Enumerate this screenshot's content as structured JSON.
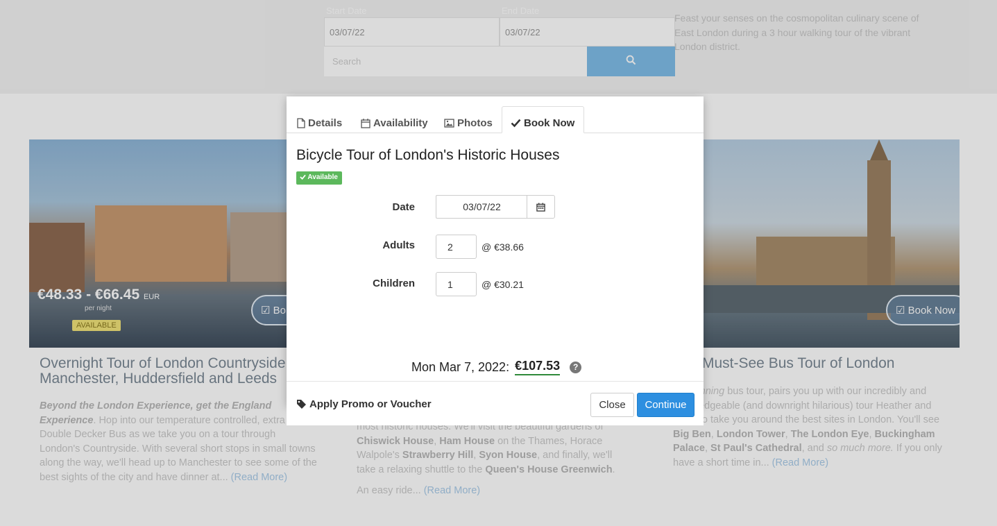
{
  "hero": {
    "start_date_label": "Start Date",
    "end_date_label": "End Date",
    "start_date_value": "03/07/22",
    "end_date_value": "03/07/22",
    "search_placeholder": "Search",
    "description": "Feast your senses on the cosmopolitan culinary scene of East London during a 3 hour walking tour of the vibrant London district."
  },
  "cards": {
    "left": {
      "price": "€48.33 - €66.45",
      "currency": "EUR",
      "per_night": "per night",
      "badge": "AVAILABLE",
      "book_label": "Bo",
      "title": "Overnight Tour of London Countryside, Manchester, Huddersfield and Leeds",
      "desc_bold": "Beyond the London Experience, get the England Experience",
      "desc_text": ". Hop into our temperature controlled, extra comfy, Double Decker Bus as we take you on a tour through London's Countryside. With several short stops in small towns along the way, we'll head up to Manchester to see some of the best sights of the city and have dinner at... ",
      "read_more": "(Read More)"
    },
    "middle": {
      "line1": "most historic houses. We'll visit the beautiful gardens of",
      "b1": "Chiswick House",
      "sep1": ", ",
      "b2": "Ham House",
      "t2": " on the Thames, Horace Walpole's ",
      "b3": "Strawberry Hill",
      "sep2": ", ",
      "b4": "Syon House",
      "t3": ", and finally, we'll take a relaxing shuttle to the ",
      "b5": "Queen's House Greenwich",
      "t4": ".",
      "easy_ride": "An easy ride... ",
      "read_more": "(Read More)"
    },
    "right": {
      "book_label": "Book Now",
      "title": "Must-See Bus Tour of London",
      "i1": "ard winning",
      "t1": " bus tour, pairs you up with our incredibly",
      "t2": " and knowledgeable (and downright hilarious) tour",
      "t3": " Heather and Sam, to take you around the best sites in London. You'll see ",
      "b1": "Big Ben",
      "s1": ", ",
      "b2": "London Tower",
      "s2": ", ",
      "b3": "The London Eye",
      "s3": ", ",
      "b4": "Buckingham Palace",
      "s4": ", ",
      "b5": "St Paul's Cathedral",
      "t4": ", and ",
      "i2": "so much more.",
      "t5": " If you only have a short time in... ",
      "read_more": "(Read More)"
    }
  },
  "modal": {
    "tabs": [
      {
        "label": "Details",
        "icon": "file-icon"
      },
      {
        "label": "Availability",
        "icon": "calendar-icon"
      },
      {
        "label": "Photos",
        "icon": "image-icon"
      },
      {
        "label": "Book Now",
        "icon": "check-icon",
        "active": true
      }
    ],
    "title": "Bicycle Tour of London's Historic Houses",
    "status": "Available",
    "form": {
      "date_label": "Date",
      "date_value": "03/07/22",
      "adults_label": "Adults",
      "adults_value": "2",
      "adults_price": "@ €38.66",
      "children_label": "Children",
      "children_value": "1",
      "children_price": "@ €30.21"
    },
    "total_date": "Mon Mar 7, 2022:",
    "total_amount": "€107.53",
    "footer": {
      "promo_label": "Apply Promo or Voucher",
      "close_label": "Close",
      "continue_label": "Continue"
    }
  },
  "colors": {
    "primary": "#2d8fe0",
    "success": "#5cb85c",
    "total_underline": "#2f8a3a"
  }
}
